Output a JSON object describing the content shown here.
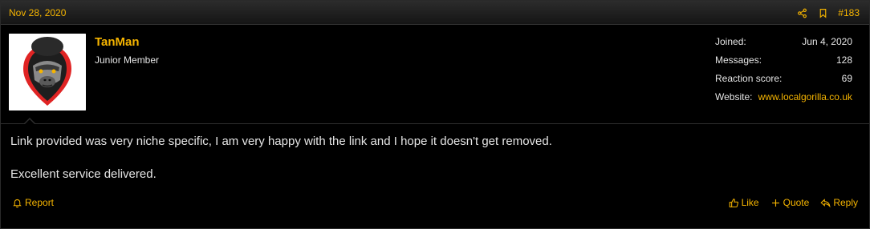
{
  "post": {
    "date": "Nov 28, 2020",
    "number": "#183",
    "header_icons": [
      "share-icon",
      "bookmark-icon"
    ]
  },
  "user": {
    "name": "TanMan",
    "title": "Junior Member",
    "avatar": "gorilla-logo"
  },
  "stats": {
    "joined_label": "Joined:",
    "joined_value": "Jun 4, 2020",
    "messages_label": "Messages:",
    "messages_value": "128",
    "reaction_label": "Reaction score:",
    "reaction_value": "69",
    "website_label": "Website:",
    "website_value": "www.localgorilla.co.uk"
  },
  "message": {
    "line1": "Link provided was very niche specific, I am very happy with the link and I hope it doesn't get removed.",
    "line2": "Excellent service delivered."
  },
  "footer": {
    "report_label": "Report",
    "like_label": "Like",
    "quote_label": "Quote",
    "reply_label": "Reply"
  },
  "colors": {
    "accent": "#f5b400",
    "background": "#000000",
    "text": "#e6e6e6"
  }
}
